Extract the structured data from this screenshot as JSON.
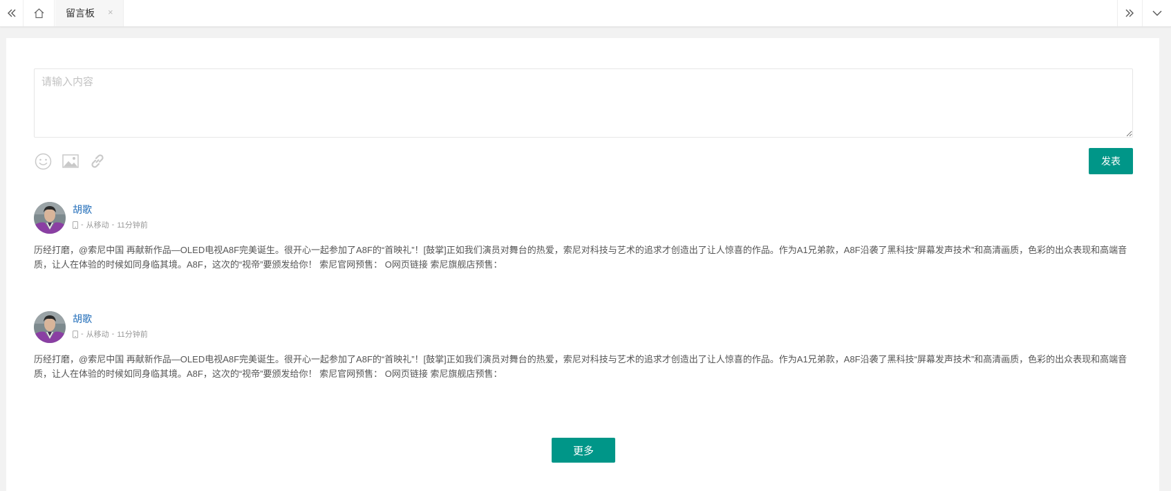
{
  "tabbar": {
    "active_tab": "留言板",
    "close_glyph": "×",
    "icons": [
      "double-chevron-left-icon",
      "home-icon",
      "close-icon",
      "double-chevron-right-icon",
      "chevron-down-icon"
    ]
  },
  "editor": {
    "placeholder": "请输入内容",
    "tools": [
      "smiley-icon",
      "image-icon",
      "link-icon"
    ],
    "submit_label": "发表"
  },
  "comments": [
    {
      "user": "胡歌",
      "source": "从移动",
      "sep": "-",
      "time": "11分钟前",
      "content": "历经打磨，@索尼中国 再献新作品—OLED电视A8F完美诞生。很开心一起参加了A8F的“首映礼”！[鼓掌]正如我们演员对舞台的热爱，索尼对科技与艺术的追求才创造出了让人惊喜的作品。作为A1兄弟款，A8F沿袭了黑科技“屏幕发声技术”和高清画质，色彩的出众表现和高端音质，让人在体验的时候如同身临其境。A8F，这次的“视帝”要颁发给你！ 索尼官网预售： O网页链接 索尼旗舰店预售："
    },
    {
      "user": "胡歌",
      "source": "从移动",
      "sep": "-",
      "time": "11分钟前",
      "content": "历经打磨，@索尼中国 再献新作品—OLED电视A8F完美诞生。很开心一起参加了A8F的“首映礼”！[鼓掌]正如我们演员对舞台的热爱，索尼对科技与艺术的追求才创造出了让人惊喜的作品。作为A1兄弟款，A8F沿袭了黑科技“屏幕发声技术”和高清画质，色彩的出众表现和高端音质，让人在体验的时候如同身临其境。A8F，这次的“视帝”要颁发给你！ 索尼官网预售： O网页链接 索尼旗舰店预售："
    }
  ],
  "more_label": "更多",
  "colors": {
    "accent": "#009688",
    "username": "#1e6bb8",
    "page_bg": "#f2f2f2"
  }
}
